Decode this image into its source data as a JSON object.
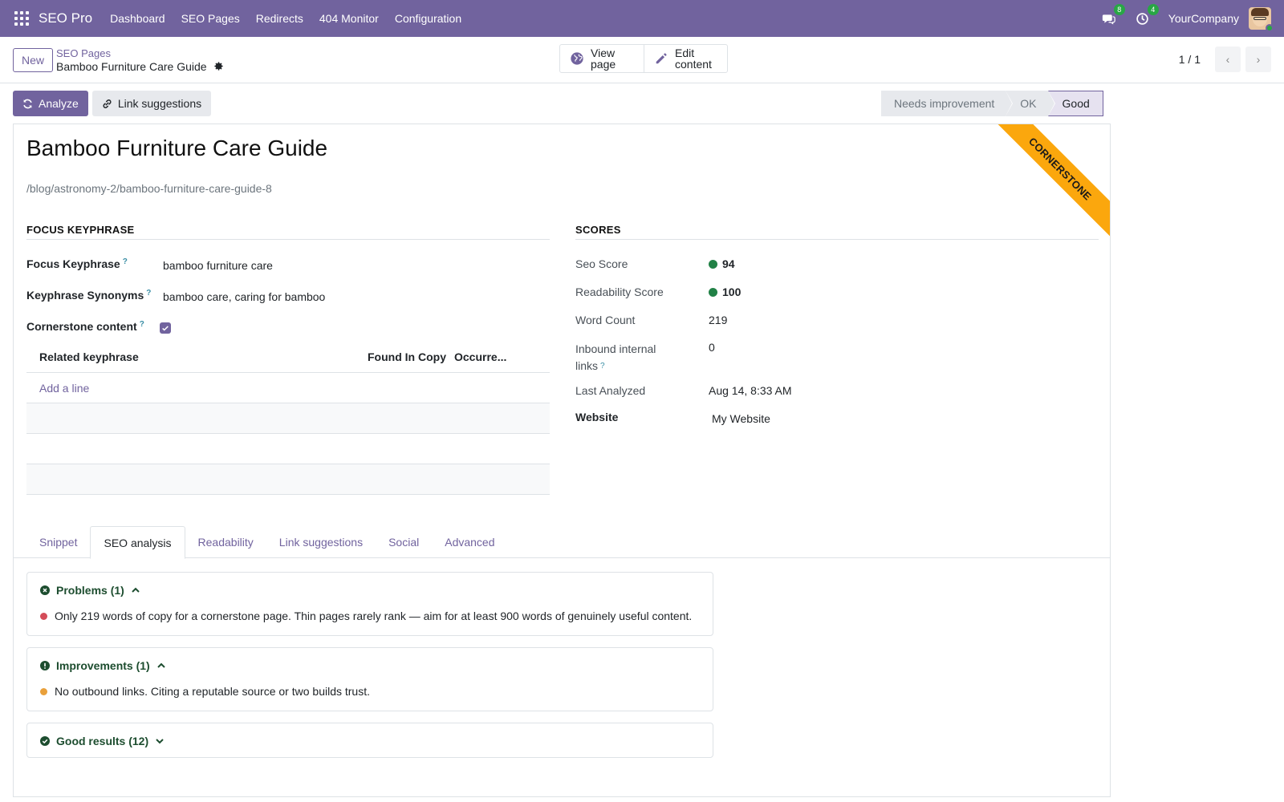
{
  "app": {
    "title": "SEO Pro"
  },
  "nav": {
    "items": [
      "Dashboard",
      "SEO Pages",
      "Redirects",
      "404 Monitor",
      "Configuration"
    ],
    "messages_count": "8",
    "activities_count": "4",
    "company": "YourCompany"
  },
  "control": {
    "new_label": "New",
    "breadcrumb_parent": "SEO Pages",
    "breadcrumb_current": "Bamboo Furniture Care Guide",
    "view_page": [
      "View",
      "page"
    ],
    "edit_content": [
      "Edit",
      "content"
    ],
    "pager": "1 / 1"
  },
  "actions": {
    "analyze": "Analyze",
    "link_suggestions": "Link suggestions"
  },
  "stages": [
    "Needs improvement",
    "OK",
    "Good"
  ],
  "active_stage": "Good",
  "record": {
    "title": "Bamboo Furniture Care Guide",
    "url": "/blog/astronomy-2/bamboo-furniture-care-guide-8",
    "ribbon": "CORNERSTONE"
  },
  "focus": {
    "heading": "FOCUS KEYPHRASE",
    "keyphrase_label": "Focus Keyphrase",
    "keyphrase": "bamboo furniture care",
    "synonyms_label": "Keyphrase Synonyms",
    "synonyms": "bamboo care, caring for bamboo",
    "cornerstone_label": "Cornerstone content",
    "cornerstone": true,
    "help_mark": "?"
  },
  "related": {
    "columns": [
      "Related keyphrase",
      "Found In Copy",
      "Occurre..."
    ],
    "add_line": "Add a line"
  },
  "scores": {
    "heading": "SCORES",
    "seo_label": "Seo Score",
    "seo": "94",
    "readability_label": "Readability Score",
    "readability": "100",
    "word_count_label": "Word Count",
    "word_count": "219",
    "inbound_label_1": "Inbound internal",
    "inbound_label_2": "links",
    "inbound": "0",
    "last_analyzed_label": "Last Analyzed",
    "last_analyzed": "Aug 14, 8:33 AM",
    "website_label": "Website",
    "website": "My Website"
  },
  "tabs": [
    "Snippet",
    "SEO analysis",
    "Readability",
    "Link suggestions",
    "Social",
    "Advanced"
  ],
  "active_tab": "SEO analysis",
  "analysis": {
    "problems_title": "Problems (1)",
    "problems": [
      "Only 219 words of copy for a cornerstone page. Thin pages rarely rank — aim for at least 900 words of genuinely useful content."
    ],
    "improvements_title": "Improvements (1)",
    "improvements": [
      "No outbound links. Citing a reputable source or two builds trust."
    ],
    "good_title": "Good results (12)"
  },
  "colors": {
    "brand": "#71639e",
    "good": "#218146",
    "problem": "#d44c59",
    "improvement": "#e9a03b",
    "ribbon": "#fba70d"
  }
}
